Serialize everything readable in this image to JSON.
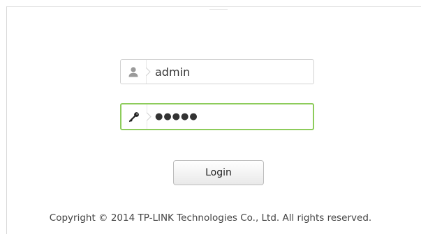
{
  "login_form": {
    "username": {
      "icon": "user-icon",
      "value": "admin"
    },
    "password": {
      "icon": "key-icon",
      "masked_value": "●●●●●"
    },
    "login_button_label": "Login"
  },
  "footer": {
    "copyright": "Copyright © 2014 TP-LINK Technologies Co., Ltd. All rights reserved."
  },
  "colors": {
    "focus_border": "#8dcc5b",
    "field_border": "#d2d2d2",
    "icon_gray": "#9a9a9a",
    "icon_dark": "#222222"
  }
}
